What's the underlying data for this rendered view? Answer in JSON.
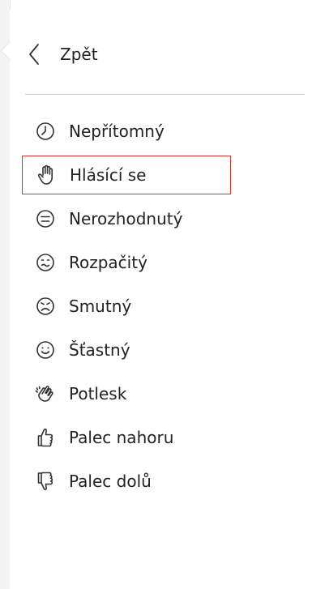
{
  "back": {
    "label": "Zpět",
    "icon": "chevron-left-icon"
  },
  "items": [
    {
      "label": "Nepřítomný",
      "icon": "clock-icon"
    },
    {
      "label": "Hlásící se",
      "icon": "raised-hand-icon",
      "selected": true
    },
    {
      "label": "Nerozhodnutý",
      "icon": "neutral-face-icon"
    },
    {
      "label": "Rozpačitý",
      "icon": "confused-face-icon"
    },
    {
      "label": "Smutný",
      "icon": "sad-face-icon"
    },
    {
      "label": "Šťastný",
      "icon": "happy-face-icon"
    },
    {
      "label": "Potlesk",
      "icon": "clapping-hands-icon"
    },
    {
      "label": "Palec nahoru",
      "icon": "thumbs-up-icon"
    },
    {
      "label": "Palec dolů",
      "icon": "thumbs-down-icon"
    }
  ],
  "colors": {
    "selection_border": "#d9302a",
    "text": "#222222",
    "divider": "#c9c9c9"
  }
}
